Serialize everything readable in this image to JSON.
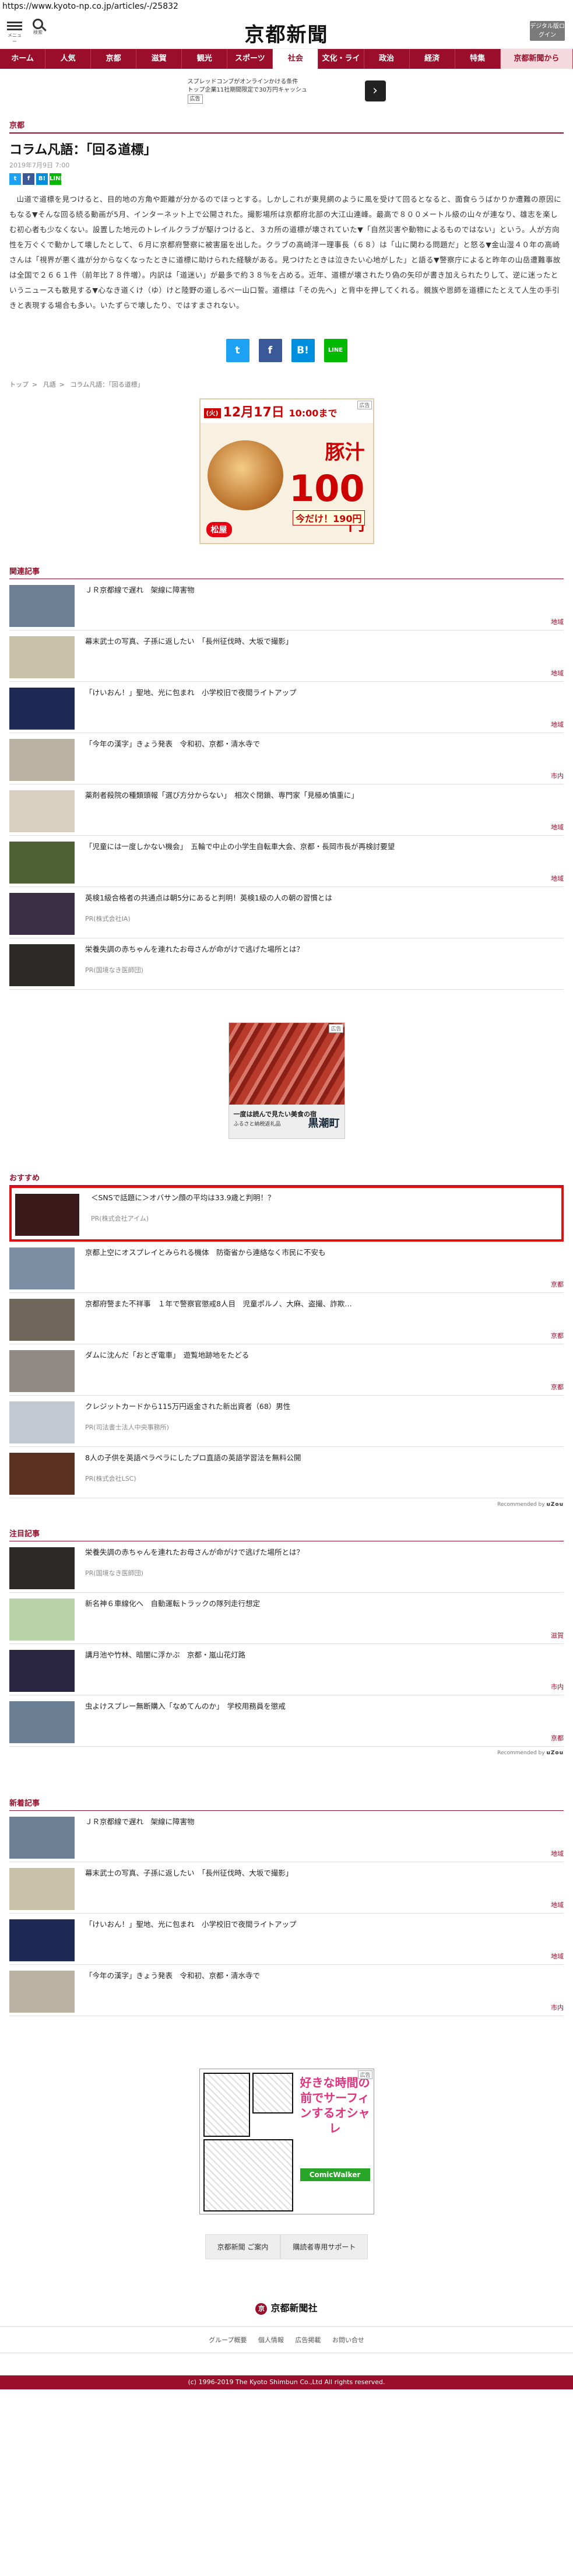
{
  "url": "https://www.kyoto-np.co.jp/articles/-/25832",
  "header": {
    "menu_label": "メニュー",
    "search_label": "検索",
    "logo": "京都新聞",
    "digital_btn": "デジタル版ログイン"
  },
  "nav": [
    "ホーム",
    "人気",
    "京都",
    "滋賀",
    "観光",
    "スポーツ",
    "社会",
    "文化・ライフ",
    "政治",
    "経済",
    "特集",
    "京都新聞から"
  ],
  "top_ad": {
    "line1": "スプレッドコンブがオンラインかける条件",
    "line2": "トップ企業11社期間限定で30万円キャッシュ",
    "tag": "広告",
    "arrow": "›"
  },
  "article": {
    "section": "京都",
    "title": "コラム凡語：「回る道標」",
    "date": "2019年7月9日 7:00",
    "body": "山道で道標を見つけると、目的地の方角や距離が分かるのでほっとする。しかしこれが東見網のように風を受けて回るとなると、面食らうばかりか遭難の原因にもなる▼そんな回る続る動画が5月、インターネット上で公開された。撮影場所は京都府北部の大江山連峰。最高で８００メートル級の山々が連なり、雄志を楽しむ初心者も少なくない。設置した地元のトレイルクラブが駆けつけると、３カ所の道標が壊されていた▼「自然災害や動物によるものではない」という。人が方向性を万ぐくで動かして壊したとして、６月に京都府警察に被害届を出した。クラブの高崎洋一理事長（６８）は「山に関わる問題だ」と怒る▼金山湿４０年の高崎さんは「視界が悪く進が分からなくなったときに道標に助けられた経験がある。見つけたときは泣きたい心地がした」と語る▼警察庁によると昨年の山岳遭難事故は全国で２６６１件（前年比７８件増）。内訳は「道迷い」が最多で約３８％を占める。近年、道標が壊されたり偽の矢印が書き加えられたりして、逆に迷ったというニュースも散見する▼心なき道くけ（ゆ）けと陸野の道しるべ一山口誓。道標は「その先へ」と背中を押してくれる。親族や恩師を道標にたとえて人生の手引きと表現する場合も多い。いたずらで壊したり、ではすまされない。"
  },
  "share": {
    "twitter": "t",
    "facebook": "f",
    "hatena": "B!",
    "line": "LINE"
  },
  "breadcrumb": [
    "トップ",
    "凡語",
    "コラム凡語：「回る道標」"
  ],
  "ad_banner": {
    "date": "12月17日",
    "day": "(火)",
    "time": "10:00まで",
    "product": "豚汁",
    "price": "100",
    "unit": "円",
    "note": "今だけ！190円",
    "brand": "松屋",
    "tag": "広告"
  },
  "related": {
    "label": "関連記事",
    "items": [
      {
        "title": "ＪＲ京都線で遅れ　架線に障害物",
        "sub": "",
        "cat": "地域",
        "color": "#6d7f92"
      },
      {
        "title": "幕末武士の写真、子孫に返したい　「長州征伐時、大坂で撮影」",
        "sub": "",
        "cat": "地域",
        "color": "#c9c0a8"
      },
      {
        "title": "「けいおん！」聖地、光に包まれ　小学校旧で夜間ライトアップ",
        "sub": "",
        "cat": "地域",
        "color": "#1d2a55"
      },
      {
        "title": "「今年の漢字」きょう発表　令和初、京都・清水寺で",
        "sub": "",
        "cat": "市内",
        "color": "#b9b2a2"
      },
      {
        "title": "薬剤者殺院の種類頭報「選び方分からない」　相次ぐ閉鎖、専門家「見極め慎重に」",
        "sub": "",
        "cat": "地域",
        "color": "#d8cfc0"
      },
      {
        "title": "「児童には一度しかない機会」　五輪で中止の小学生自転車大会、京都・長岡市長が再検討要望",
        "sub": "",
        "cat": "地域",
        "color": "#4d6135"
      },
      {
        "title": "英検1級合格者の共通点は朝5分にあると判明！英検1級の人の朝の習慣とは",
        "sub": "PR(株式会社IA)",
        "cat": "",
        "color": "#3b2f45"
      },
      {
        "title": "栄養失調の赤ちゃんを連れたお母さんが命がけで逃げた場所とは？",
        "sub": "PR(国境なき医師団)",
        "cat": "",
        "color": "#2c2a28"
      }
    ]
  },
  "ad_square": {
    "line1": "一度は読んで見たい美食の宿",
    "line2": "ふるさと納税返礼品",
    "brand": "黒潮町",
    "tag": "広告"
  },
  "osusume": {
    "label": "おすすめ",
    "items": [
      {
        "title": "＜SNSで話題に＞オバサン顔の平均は33.9歳と判明！？",
        "sub": "PR(株式会社アイム)",
        "cat": "",
        "color": "#3a1a1a",
        "highlight": true
      },
      {
        "title": "京都上空にオスプレイとみられる機体　防衛省から連絡なく市民に不安も",
        "sub": "",
        "cat": "京都",
        "color": "#7b8ea3"
      },
      {
        "title": "京都府警また不祥事　１年で警察官懲戒8人目　児童ポルノ、大麻、盗撮、詐欺…",
        "sub": "",
        "cat": "京都",
        "color": "#70665a"
      },
      {
        "title": "ダムに沈んだ「おとぎ電車」　遊覧地跡地をたどる",
        "sub": "",
        "cat": "京都",
        "color": "#8f8a85"
      },
      {
        "title": "クレジットカードから115万円返金された新出資者（68）男性",
        "sub": "PR(司法書士法人中央事務所)",
        "cat": "",
        "color": "#c3c8d0"
      },
      {
        "title": "8人の子供を英語ペラペラにしたプロ直語の英語学習法を無料公開",
        "sub": "PR(株式会社LSC)",
        "cat": "",
        "color": "#5a3020"
      }
    ],
    "recommended_by": "Recommended by",
    "recommended_brand": "uZou"
  },
  "chumoku": {
    "label": "注目記事",
    "items": [
      {
        "title": "栄養失調の赤ちゃんを連れたお母さんが命がけで逃げた場所とは？",
        "sub": "PR(国境なき医師団)",
        "cat": "",
        "color": "#2c2a28"
      },
      {
        "title": "新名神６車線化へ　自動運転トラックの隊列走行想定",
        "sub": "",
        "cat": "滋賀",
        "color": "#b8d3a8"
      },
      {
        "title": "講月池や竹林、暗闇に浮かぶ　京都・嵐山花灯路",
        "sub": "",
        "cat": "市内",
        "color": "#2a2540"
      },
      {
        "title": "虫よけスプレー無断購入「なめてんのか」　学校用務員を懲戒",
        "sub": "",
        "cat": "京都",
        "color": "#6a7e94"
      }
    ],
    "recommended_by": "Recommended by",
    "recommended_brand": "uZou"
  },
  "shinchaku": {
    "label": "新着記事",
    "items": [
      {
        "title": "ＪＲ京都線で遅れ　架線に障害物",
        "sub": "",
        "cat": "地域",
        "color": "#6d7f92"
      },
      {
        "title": "幕末武士の写真、子孫に返したい　「長州征伐時、大坂で撮影」",
        "sub": "",
        "cat": "地域",
        "color": "#c9c0a8"
      },
      {
        "title": "「けいおん！」聖地、光に包まれ　小学校旧で夜間ライトアップ",
        "sub": "",
        "cat": "地域",
        "color": "#1d2a55"
      },
      {
        "title": "「今年の漢字」きょう発表　令和初、京都・清水寺で",
        "sub": "",
        "cat": "市内",
        "color": "#b9b2a2"
      }
    ]
  },
  "manga_ad": {
    "headline": "好きな時間の前でサーフィンするオシャレ",
    "green": "ComicWalker",
    "tag": "広告"
  },
  "subscribe": {
    "btn1": "京都新聞 ご案内",
    "btn2": "購読者専用サポート"
  },
  "footer": {
    "mark": "京",
    "logo": "京都新聞社",
    "links": [
      "グループ概要",
      "個人情報",
      "広告掲載",
      "お問い合せ"
    ],
    "copyright": "(c) 1996-2019 The Kyoto Shimbun Co.,Ltd All rights reserved."
  }
}
